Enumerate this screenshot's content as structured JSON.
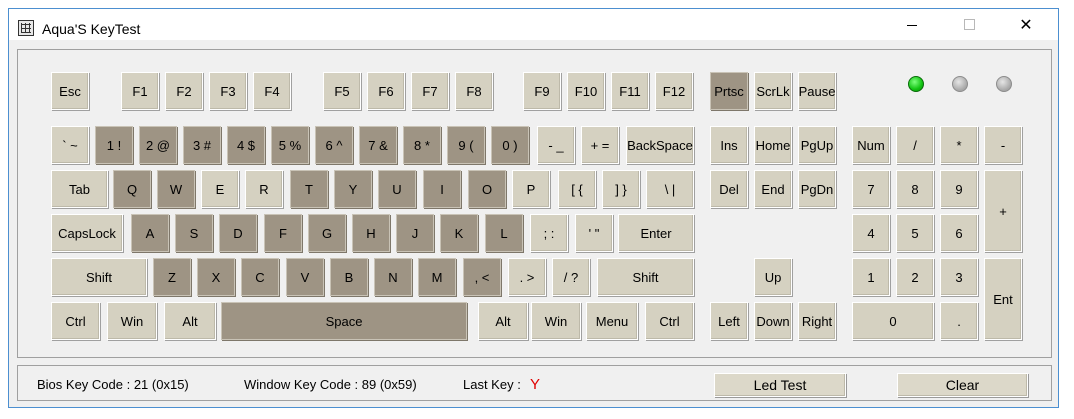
{
  "window": {
    "title": "Aqua'S KeyTest",
    "controls": [
      "minimize",
      "maximize",
      "close"
    ],
    "accent_color": "#4c8fd0"
  },
  "colors": {
    "key_default": "#d5d1c1",
    "key_pressed": "#9e9484",
    "led_on": "#12c312",
    "last_key": "#e00000"
  },
  "leds": [
    {
      "name": "led-1",
      "state": "on"
    },
    {
      "name": "led-2",
      "state": "off"
    },
    {
      "name": "led-3",
      "state": "off"
    }
  ],
  "keys": [
    {
      "id": "esc",
      "label": "Esc",
      "pressed": false
    },
    {
      "id": "f1",
      "label": "F1",
      "pressed": false
    },
    {
      "id": "f2",
      "label": "F2",
      "pressed": false
    },
    {
      "id": "f3",
      "label": "F3",
      "pressed": false
    },
    {
      "id": "f4",
      "label": "F4",
      "pressed": false
    },
    {
      "id": "f5",
      "label": "F5",
      "pressed": false
    },
    {
      "id": "f6",
      "label": "F6",
      "pressed": false
    },
    {
      "id": "f7",
      "label": "F7",
      "pressed": false
    },
    {
      "id": "f8",
      "label": "F8",
      "pressed": false
    },
    {
      "id": "f9",
      "label": "F9",
      "pressed": false
    },
    {
      "id": "f10",
      "label": "F10",
      "pressed": false
    },
    {
      "id": "f11",
      "label": "F11",
      "pressed": false
    },
    {
      "id": "f12",
      "label": "F12",
      "pressed": false
    },
    {
      "id": "prtsc",
      "label": "Prtsc",
      "pressed": true
    },
    {
      "id": "scrlk",
      "label": "ScrLk",
      "pressed": false
    },
    {
      "id": "pause",
      "label": "Pause",
      "pressed": false
    },
    {
      "id": "backtick",
      "label": "` ~",
      "pressed": false
    },
    {
      "id": "1",
      "label": "1 !",
      "pressed": true
    },
    {
      "id": "2",
      "label": "2 @",
      "pressed": true
    },
    {
      "id": "3",
      "label": "3 #",
      "pressed": true
    },
    {
      "id": "4",
      "label": "4 $",
      "pressed": true
    },
    {
      "id": "5",
      "label": "5 %",
      "pressed": true
    },
    {
      "id": "6",
      "label": "6 ^",
      "pressed": true
    },
    {
      "id": "7",
      "label": "7 &",
      "pressed": true
    },
    {
      "id": "8",
      "label": "8 *",
      "pressed": true
    },
    {
      "id": "9",
      "label": "9 (",
      "pressed": true
    },
    {
      "id": "0",
      "label": "0 )",
      "pressed": true
    },
    {
      "id": "minus",
      "label": "- _",
      "pressed": false
    },
    {
      "id": "equals",
      "label": "+ =",
      "pressed": false
    },
    {
      "id": "backspace",
      "label": "BackSpace",
      "pressed": false
    },
    {
      "id": "ins",
      "label": "Ins",
      "pressed": false
    },
    {
      "id": "home",
      "label": "Home",
      "pressed": false
    },
    {
      "id": "pgup",
      "label": "PgUp",
      "pressed": false
    },
    {
      "id": "num",
      "label": "Num",
      "pressed": false
    },
    {
      "id": "num-slash",
      "label": "/",
      "pressed": false
    },
    {
      "id": "num-star",
      "label": "*",
      "pressed": false
    },
    {
      "id": "num-minus",
      "label": "-",
      "pressed": false
    },
    {
      "id": "tab",
      "label": "Tab",
      "pressed": false
    },
    {
      "id": "q",
      "label": "Q",
      "pressed": true
    },
    {
      "id": "w",
      "label": "W",
      "pressed": true
    },
    {
      "id": "e",
      "label": "E",
      "pressed": false
    },
    {
      "id": "r",
      "label": "R",
      "pressed": false
    },
    {
      "id": "t",
      "label": "T",
      "pressed": true
    },
    {
      "id": "y",
      "label": "Y",
      "pressed": true
    },
    {
      "id": "u",
      "label": "U",
      "pressed": true
    },
    {
      "id": "i",
      "label": "I",
      "pressed": true
    },
    {
      "id": "o",
      "label": "O",
      "pressed": true
    },
    {
      "id": "p",
      "label": "P",
      "pressed": false
    },
    {
      "id": "lbracket",
      "label": "[ {",
      "pressed": false
    },
    {
      "id": "rbracket",
      "label": "] }",
      "pressed": false
    },
    {
      "id": "backslash",
      "label": "\\ |",
      "pressed": false
    },
    {
      "id": "del",
      "label": "Del",
      "pressed": false
    },
    {
      "id": "end",
      "label": "End",
      "pressed": false
    },
    {
      "id": "pgdn",
      "label": "PgDn",
      "pressed": false
    },
    {
      "id": "num7",
      "label": "7",
      "pressed": false
    },
    {
      "id": "num8",
      "label": "8",
      "pressed": false
    },
    {
      "id": "num9",
      "label": "9",
      "pressed": false
    },
    {
      "id": "num-plus",
      "label": "+",
      "pressed": false
    },
    {
      "id": "capslock",
      "label": "CapsLock",
      "pressed": false
    },
    {
      "id": "a",
      "label": "A",
      "pressed": true
    },
    {
      "id": "s",
      "label": "S",
      "pressed": true
    },
    {
      "id": "d",
      "label": "D",
      "pressed": true
    },
    {
      "id": "f",
      "label": "F",
      "pressed": true
    },
    {
      "id": "g",
      "label": "G",
      "pressed": true
    },
    {
      "id": "h",
      "label": "H",
      "pressed": true
    },
    {
      "id": "j",
      "label": "J",
      "pressed": true
    },
    {
      "id": "k",
      "label": "K",
      "pressed": true
    },
    {
      "id": "l",
      "label": "L",
      "pressed": true
    },
    {
      "id": "semicolon",
      "label": "; :",
      "pressed": false
    },
    {
      "id": "quote",
      "label": "' \"",
      "pressed": false
    },
    {
      "id": "enter",
      "label": "Enter",
      "pressed": false
    },
    {
      "id": "num4",
      "label": "4",
      "pressed": false
    },
    {
      "id": "num5",
      "label": "5",
      "pressed": false
    },
    {
      "id": "num6",
      "label": "6",
      "pressed": false
    },
    {
      "id": "lshift",
      "label": "Shift",
      "pressed": false
    },
    {
      "id": "z",
      "label": "Z",
      "pressed": true
    },
    {
      "id": "x",
      "label": "X",
      "pressed": true
    },
    {
      "id": "c",
      "label": "C",
      "pressed": true
    },
    {
      "id": "v",
      "label": "V",
      "pressed": true
    },
    {
      "id": "b",
      "label": "B",
      "pressed": true
    },
    {
      "id": "n",
      "label": "N",
      "pressed": true
    },
    {
      "id": "m",
      "label": "M",
      "pressed": true
    },
    {
      "id": "comma",
      "label": ", <",
      "pressed": true
    },
    {
      "id": "period",
      "label": ". >",
      "pressed": false
    },
    {
      "id": "slash",
      "label": "/ ?",
      "pressed": false
    },
    {
      "id": "rshift",
      "label": "Shift",
      "pressed": false
    },
    {
      "id": "up",
      "label": "Up",
      "pressed": false
    },
    {
      "id": "num1",
      "label": "1",
      "pressed": false
    },
    {
      "id": "num2",
      "label": "2",
      "pressed": false
    },
    {
      "id": "num3",
      "label": "3",
      "pressed": false
    },
    {
      "id": "num-enter",
      "label": "Ent",
      "pressed": false
    },
    {
      "id": "lctrl",
      "label": "Ctrl",
      "pressed": false
    },
    {
      "id": "lwin",
      "label": "Win",
      "pressed": false
    },
    {
      "id": "lalt",
      "label": "Alt",
      "pressed": false
    },
    {
      "id": "space",
      "label": "Space",
      "pressed": true
    },
    {
      "id": "ralt",
      "label": "Alt",
      "pressed": false
    },
    {
      "id": "rwin",
      "label": "Win",
      "pressed": false
    },
    {
      "id": "menu",
      "label": "Menu",
      "pressed": false
    },
    {
      "id": "rctrl",
      "label": "Ctrl",
      "pressed": false
    },
    {
      "id": "left",
      "label": "Left",
      "pressed": false
    },
    {
      "id": "down",
      "label": "Down",
      "pressed": false
    },
    {
      "id": "right",
      "label": "Right",
      "pressed": false
    },
    {
      "id": "num0",
      "label": "0",
      "pressed": false
    },
    {
      "id": "num-dot",
      "label": ".",
      "pressed": false
    }
  ],
  "status": {
    "bios_key_code": "Bios Key Code : 21 (0x15)",
    "window_key_code": "Window Key Code : 89 (0x59)",
    "last_key_label": "Last Key :",
    "last_key_value": "Y",
    "led_test_label": "Led Test",
    "clear_label": "Clear"
  }
}
